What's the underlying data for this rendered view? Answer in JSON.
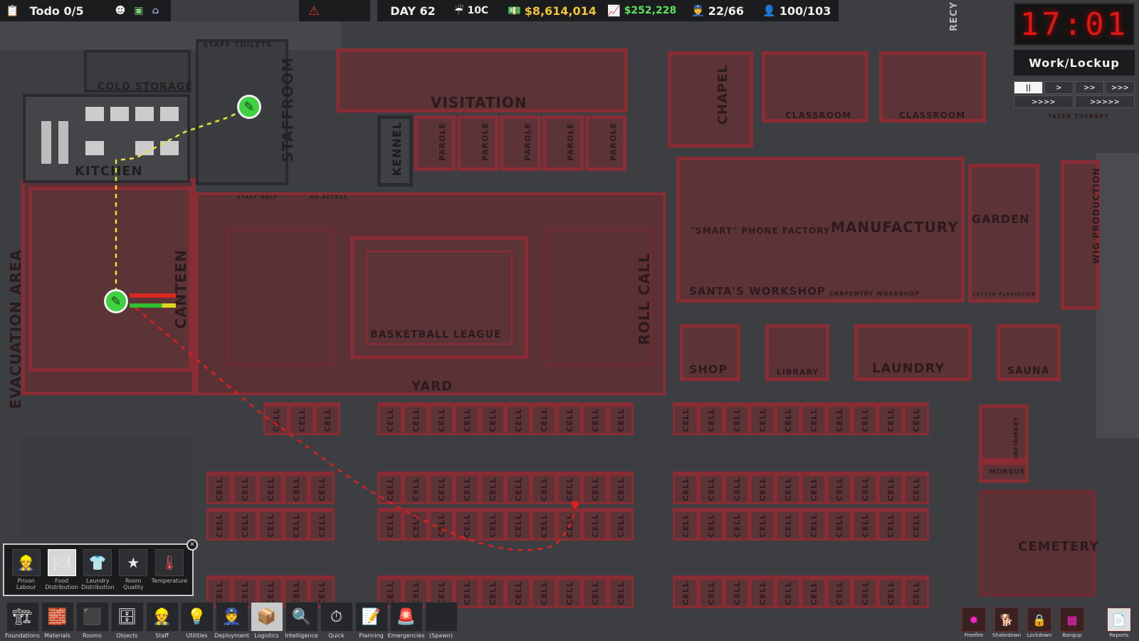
{
  "topbar": {
    "todo": "Todo 0/5",
    "day": "DAY 62",
    "temperature": "10C",
    "money": "$8,614,014",
    "income": "$252,228",
    "guards": "22/66",
    "prisoners": "100/103"
  },
  "clock": {
    "time": "17:01",
    "regime": "Work/Lockup"
  },
  "speed_buttons": [
    "||",
    ">",
    ">>",
    ">>>",
    ">>>>",
    ">>>>>"
  ],
  "speed_active_index": 0,
  "rooms": {
    "visitation": "VISITATION",
    "chapel": "CHAPEL",
    "classroom1": "CLASSROOM",
    "classroom2": "CLASSROOM",
    "kennel": "KENNEL",
    "parole": "PAROLE",
    "staffroom": "STAFFROOM",
    "staff_toilets": "STAFF TOILETS",
    "cold_storage": "COLD STORAGE",
    "kitchen": "KITCHEN",
    "canteen": "CANTEEN",
    "evacuation": "EVACUATION AREA",
    "smartphone": "\"SMART\" PHONE FACTORY",
    "manufactury": "MANUFACTURY",
    "santas": "SANTA'S WORKSHOP",
    "carpentry": "CARPENTRY WORKSHOP",
    "garden": "GARDEN",
    "cotton": "COTTON PLANTATION",
    "wig": "WIG PRODUCTION",
    "basketball": "BASKETBALL LEAGUE",
    "roll_call": "ROLL CALL",
    "yard": "YARD",
    "shop": "SHOP",
    "library": "LIBRARY",
    "laundry": "LAUNDRY",
    "sauna": "SAUNA",
    "morgue": "MORGUE",
    "cemetery": "CEMETERY",
    "infirmary": "INFIRMARY",
    "cell": "CELL",
    "recy": "RECY",
    "taser": "TAZER THERAPY",
    "staff_only": "STAFF ONLY",
    "no_access": "NO ACCESS"
  },
  "logistics_popup": {
    "items": [
      {
        "label": "Prison Labour",
        "icon": "prison-labour-icon"
      },
      {
        "label": "Food Distribution",
        "icon": "food-distribution-icon"
      },
      {
        "label": "Laundry Distribution",
        "icon": "laundry-distribution-icon"
      },
      {
        "label": "Room Quality",
        "icon": "room-quality-icon"
      },
      {
        "label": "Temperature",
        "icon": "temperature-icon"
      }
    ],
    "active_index": 1
  },
  "toolbar": [
    {
      "label": "Foundations",
      "icon": "foundations-icon",
      "glyph": "🏗"
    },
    {
      "label": "Materials",
      "icon": "materials-icon",
      "glyph": "🧱"
    },
    {
      "label": "Rooms",
      "icon": "rooms-icon",
      "glyph": "⬛"
    },
    {
      "label": "Objects",
      "icon": "objects-icon",
      "glyph": "🗄"
    },
    {
      "label": "Staff",
      "icon": "staff-icon",
      "glyph": "👷"
    },
    {
      "label": "Utilities",
      "icon": "utilities-icon",
      "glyph": "💡"
    },
    {
      "label": "Deployment",
      "icon": "deployment-icon",
      "glyph": "👮"
    },
    {
      "label": "Logistics",
      "icon": "logistics-icon",
      "glyph": "📦"
    },
    {
      "label": "Intelligence",
      "icon": "intelligence-icon",
      "glyph": "🔍"
    },
    {
      "label": "Quick",
      "icon": "quick-icon",
      "glyph": "⏱"
    },
    {
      "label": "Planning",
      "icon": "planning-icon",
      "glyph": "📝"
    },
    {
      "label": "Emergencies",
      "icon": "emergencies-icon",
      "glyph": "🚨"
    },
    {
      "label": "(Spawn)",
      "icon": "spawn-icon",
      "glyph": ""
    }
  ],
  "toolbar_active_index": 7,
  "right_tools": [
    {
      "label": "Freefire",
      "icon": "freefire-icon",
      "glyph": "✸"
    },
    {
      "label": "Shakedown",
      "icon": "shakedown-icon",
      "glyph": "🐕"
    },
    {
      "label": "Lockdown",
      "icon": "lockdown-icon",
      "glyph": "🔒"
    },
    {
      "label": "Bangup",
      "icon": "bangup-icon",
      "glyph": "▦"
    },
    {
      "label": "Reports",
      "icon": "reports-icon",
      "glyph": "📄"
    }
  ]
}
